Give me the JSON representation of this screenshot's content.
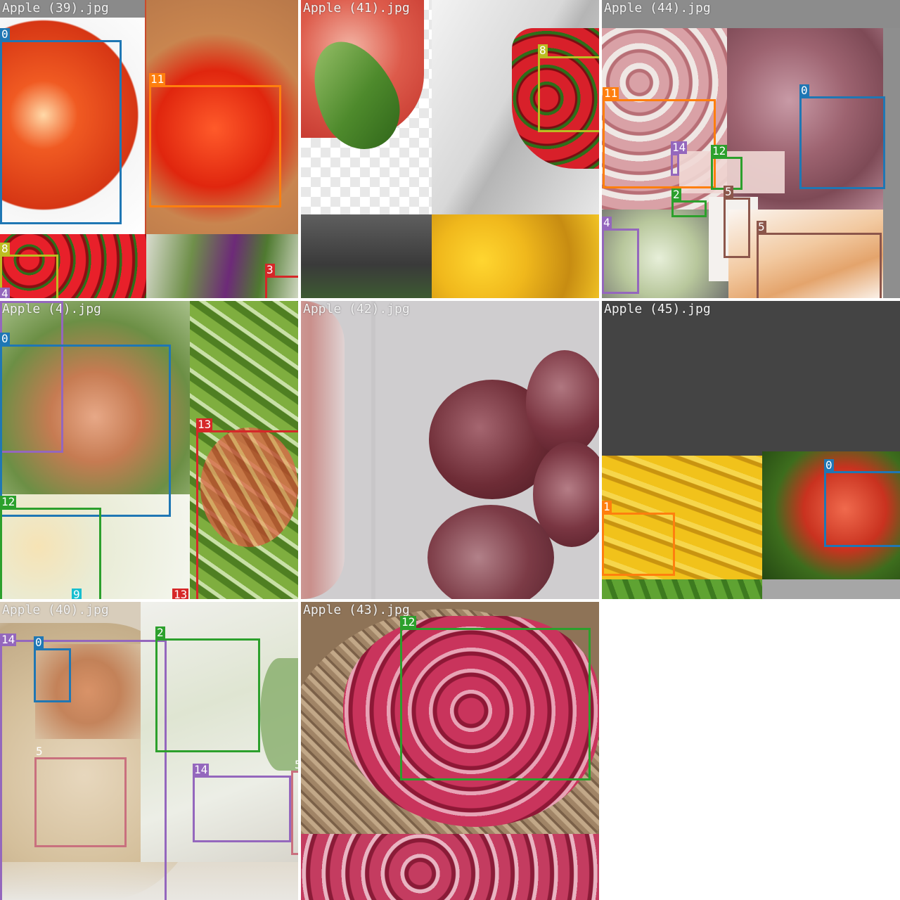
{
  "mosaic": {
    "tiles": [
      {
        "title": "Apple (39).jpg",
        "background": "#c94a2c",
        "boxes": [
          {
            "class_id": "0",
            "color": "#1f77b4"
          },
          {
            "class_id": "11",
            "color": "#ff7f0e"
          },
          {
            "class_id": "8",
            "color": "#bcbd22"
          },
          {
            "class_id": "4",
            "color": "#9467bd"
          },
          {
            "class_id": "3",
            "color": "#d62728"
          }
        ]
      },
      {
        "title": "Apple (41).jpg",
        "background": "#d9d4cf",
        "boxes": [
          {
            "class_id": "8",
            "color": "#bcbd22"
          }
        ]
      },
      {
        "title": "Apple (44).jpg",
        "background": "#9a8f8c",
        "boxes": [
          {
            "class_id": "0",
            "color": "#1f77b4"
          },
          {
            "class_id": "11",
            "color": "#ff7f0e"
          },
          {
            "class_id": "14",
            "color": "#9467bd"
          },
          {
            "class_id": "12",
            "color": "#2ca02c"
          },
          {
            "class_id": "2",
            "color": "#2ca02c"
          },
          {
            "class_id": "5",
            "color": "#8c564b"
          },
          {
            "class_id": "5",
            "color": "#8c564b"
          },
          {
            "class_id": "4",
            "color": "#9467bd"
          }
        ]
      },
      {
        "title": "Apple (4).jpg",
        "background": "#9fb27c",
        "boxes": [
          {
            "class_id": "0",
            "color": "#1f77b4"
          },
          {
            "class_id": "13",
            "color": "#d62728"
          },
          {
            "class_id": "12",
            "color": "#2ca02c"
          },
          {
            "class_id": "9",
            "color": "#17becf"
          },
          {
            "class_id": "13",
            "color": "#d62728"
          }
        ]
      },
      {
        "title": "Apple (42).jpg",
        "background": "#cfcdcf",
        "boxes": []
      },
      {
        "title": "Apple (45).jpg",
        "background": "#444444",
        "boxes": [
          {
            "class_id": "0",
            "color": "#1f77b4"
          },
          {
            "class_id": "1",
            "color": "#ff7f0e"
          }
        ]
      },
      {
        "title": "Apple (40).jpg",
        "background": "#d8cdbb",
        "boxes": [
          {
            "class_id": "14",
            "color": "#9467bd"
          },
          {
            "class_id": "0",
            "color": "#1f77b4"
          },
          {
            "class_id": "2",
            "color": "#2ca02c"
          },
          {
            "class_id": "5",
            "color": "#c9707e"
          },
          {
            "class_id": "14",
            "color": "#9467bd"
          },
          {
            "class_id": "5",
            "color": "#c9707e"
          }
        ]
      },
      {
        "title": "Apple (43).jpg",
        "background": "#8e7357",
        "boxes": [
          {
            "class_id": "12",
            "color": "#2ca02c"
          }
        ]
      }
    ]
  }
}
